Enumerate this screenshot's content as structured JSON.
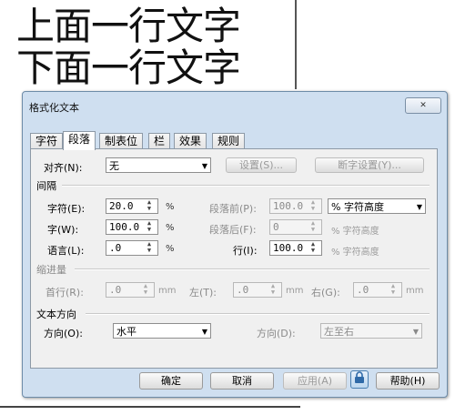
{
  "document": {
    "line1": "上面一行文字",
    "line2": "下面一行文字"
  },
  "dialog": {
    "title": "格式化文本",
    "close_icon": "✕",
    "tabs": [
      "字符",
      "段落",
      "制表位",
      "栏",
      "效果",
      "规则"
    ],
    "active_tab": "段落",
    "align": {
      "label": "对齐(N):",
      "value": "无",
      "settings_button": "设置(S)...",
      "hyphen_button": "断字设置(Y)..."
    },
    "spacing": {
      "section": "间隔",
      "char_label": "字符(E):",
      "char_value": "20.0",
      "char_unit": "%",
      "word_label": "字(W):",
      "word_value": "100.0",
      "word_unit": "%",
      "lang_label": "语言(L):",
      "lang_value": ".0",
      "lang_unit": "%",
      "before_label": "段落前(P):",
      "before_value": "100.0",
      "unit_select": "% 字符高度",
      "after_label": "段落后(F):",
      "after_value": "0",
      "after_unit": "% 字符高度",
      "line_label": "行(I):",
      "line_value": "100.0",
      "line_unit": "% 字符高度"
    },
    "indent": {
      "section": "缩进量",
      "first_label": "首行(R):",
      "first_value": ".0",
      "left_label": "左(T):",
      "left_value": ".0",
      "right_label": "右(G):",
      "right_value": ".0",
      "unit": "mm"
    },
    "direction": {
      "section": "文本方向",
      "dir_label": "方向(O):",
      "dir_value": "水平",
      "dir2_label": "方向(D):",
      "dir2_value": "左至右"
    },
    "buttons": {
      "ok": "确定",
      "cancel": "取消",
      "apply": "应用(A)",
      "help": "帮助(H)"
    },
    "icons": {
      "close": "close-icon",
      "lock": "lock-icon",
      "spinner": "spinner-arrows-icon",
      "dropdown": "chevron-down-icon"
    }
  }
}
